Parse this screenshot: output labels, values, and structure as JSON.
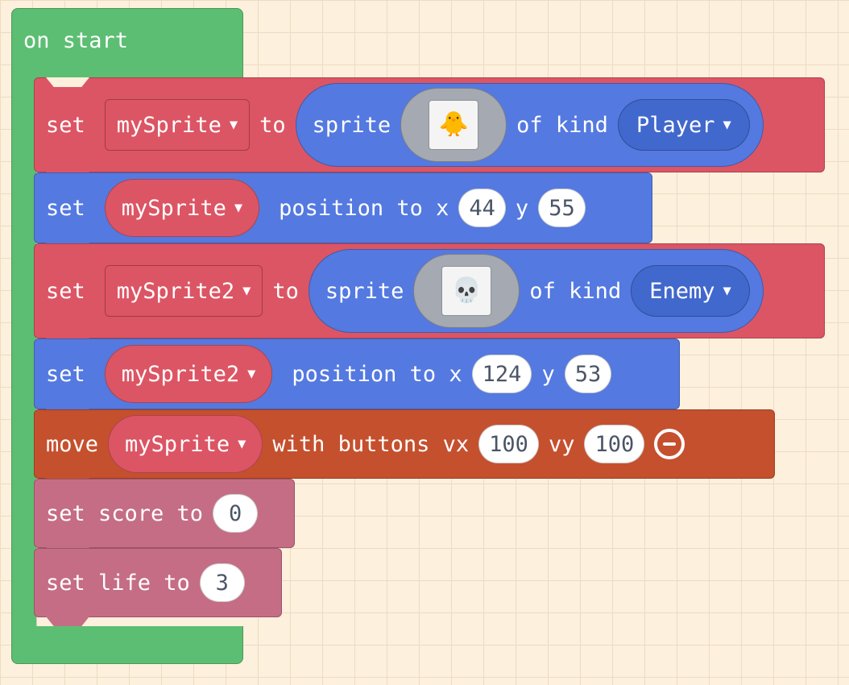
{
  "on_start": {
    "label": "on start"
  },
  "blocks": {
    "set_sprite1": {
      "set": "set",
      "variable": "mySprite",
      "to": "to",
      "sprite": "sprite",
      "image": "duck-sprite",
      "of_kind": "of kind",
      "kind": "Player"
    },
    "pos_sprite1": {
      "set": "set",
      "variable": "mySprite",
      "position_to_x": "position to x",
      "x": "44",
      "y_label": "y",
      "y": "55"
    },
    "set_sprite2": {
      "set": "set",
      "variable": "mySprite2",
      "to": "to",
      "sprite": "sprite",
      "image": "skull-sprite",
      "of_kind": "of kind",
      "kind": "Enemy"
    },
    "pos_sprite2": {
      "set": "set",
      "variable": "mySprite2",
      "position_to_x": "position to x",
      "x": "124",
      "y_label": "y",
      "y": "53"
    },
    "move": {
      "move": "move",
      "variable": "mySprite",
      "with_buttons_vx": "with buttons vx",
      "vx": "100",
      "vy_label": "vy",
      "vy": "100"
    },
    "score": {
      "label": "set score to",
      "value": "0"
    },
    "life": {
      "label": "set life to",
      "value": "3"
    }
  },
  "icons": {
    "dropdown": "▼",
    "duck": "🐥",
    "skull": "💀",
    "remove": "minus-circle-icon"
  },
  "colors": {
    "event_green": "#5cbe72",
    "variables_red": "#dc5564",
    "sprites_blue": "#5479e0",
    "controller_orange": "#c5502e",
    "info_pink": "#c56d85",
    "background": "#fdf0dc"
  }
}
